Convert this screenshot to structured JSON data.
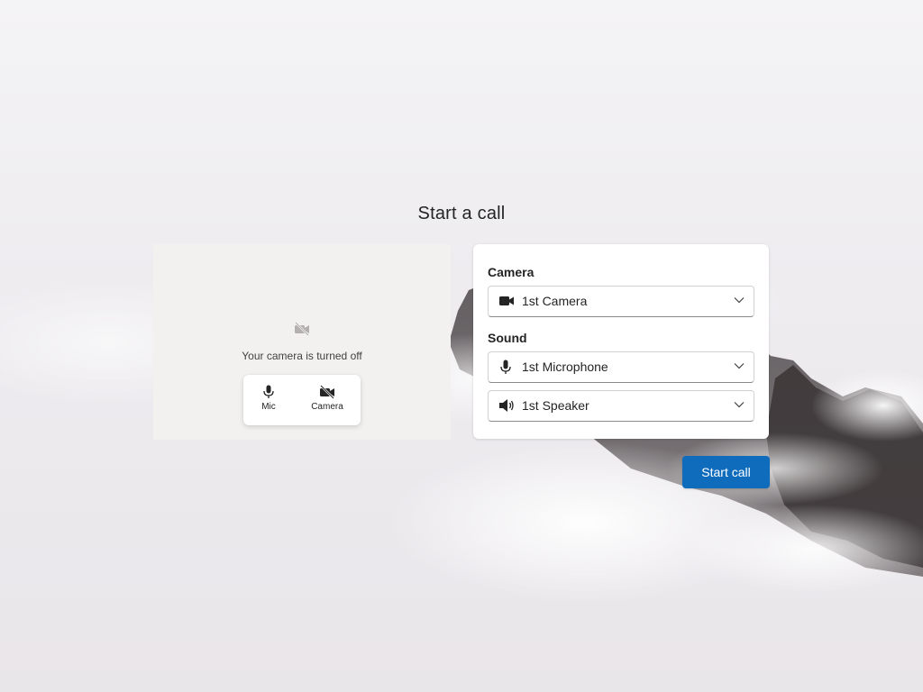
{
  "page": {
    "title": "Start a call"
  },
  "preview": {
    "camera_off_message": "Your camera is turned off",
    "mic_label": "Mic",
    "camera_label": "Camera"
  },
  "settings": {
    "camera_section_label": "Camera",
    "camera_selected": "1st Camera",
    "sound_section_label": "Sound",
    "microphone_selected": "1st Microphone",
    "speaker_selected": "1st Speaker"
  },
  "actions": {
    "start_call_label": "Start call"
  },
  "colors": {
    "primary": "#0f6cbd",
    "preview_bg": "#f2f1ef",
    "text": "#242424"
  },
  "icons": {
    "preview": "video-off-icon",
    "mic_toggle": "microphone-icon",
    "camera_toggle": "video-off-icon",
    "camera_dropdown": "video-camera-icon",
    "microphone_dropdown": "microphone-icon",
    "speaker_dropdown": "speaker-icon",
    "dropdown_chevron": "chevron-down-icon"
  }
}
